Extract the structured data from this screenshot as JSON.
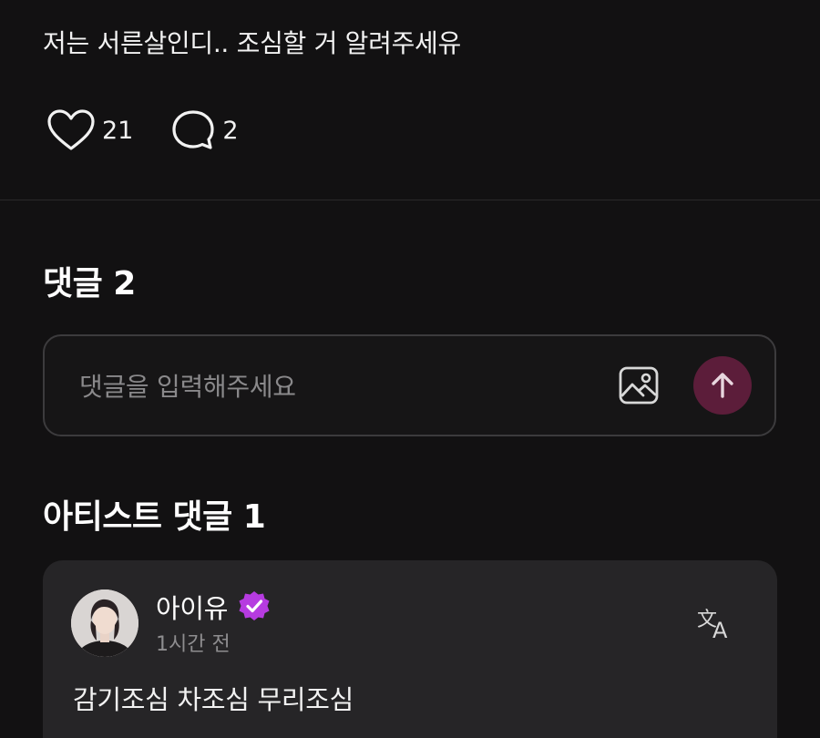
{
  "post": {
    "text": "저는 서른살인디.. 조심할 거 알려주세유",
    "likes": "21",
    "comments": "2"
  },
  "comments_section": {
    "title": "댓글 2",
    "input_placeholder": "댓글을 입력해주세요"
  },
  "artist_section": {
    "title": "아티스트 댓글 1",
    "comment": {
      "author": "아이유",
      "time": "1시간 전",
      "text": "감기조심 차조심 무리조심"
    }
  },
  "colors": {
    "background": "#121112",
    "card": "#262527",
    "send_button": "#5c1d3a",
    "verified_badge": "#b63be0"
  },
  "icons": {
    "like": "heart-icon",
    "comment": "speech-bubble-icon",
    "image": "image-icon",
    "send": "arrow-up-icon",
    "verified": "verified-badge-icon",
    "translate": "translate-icon"
  }
}
